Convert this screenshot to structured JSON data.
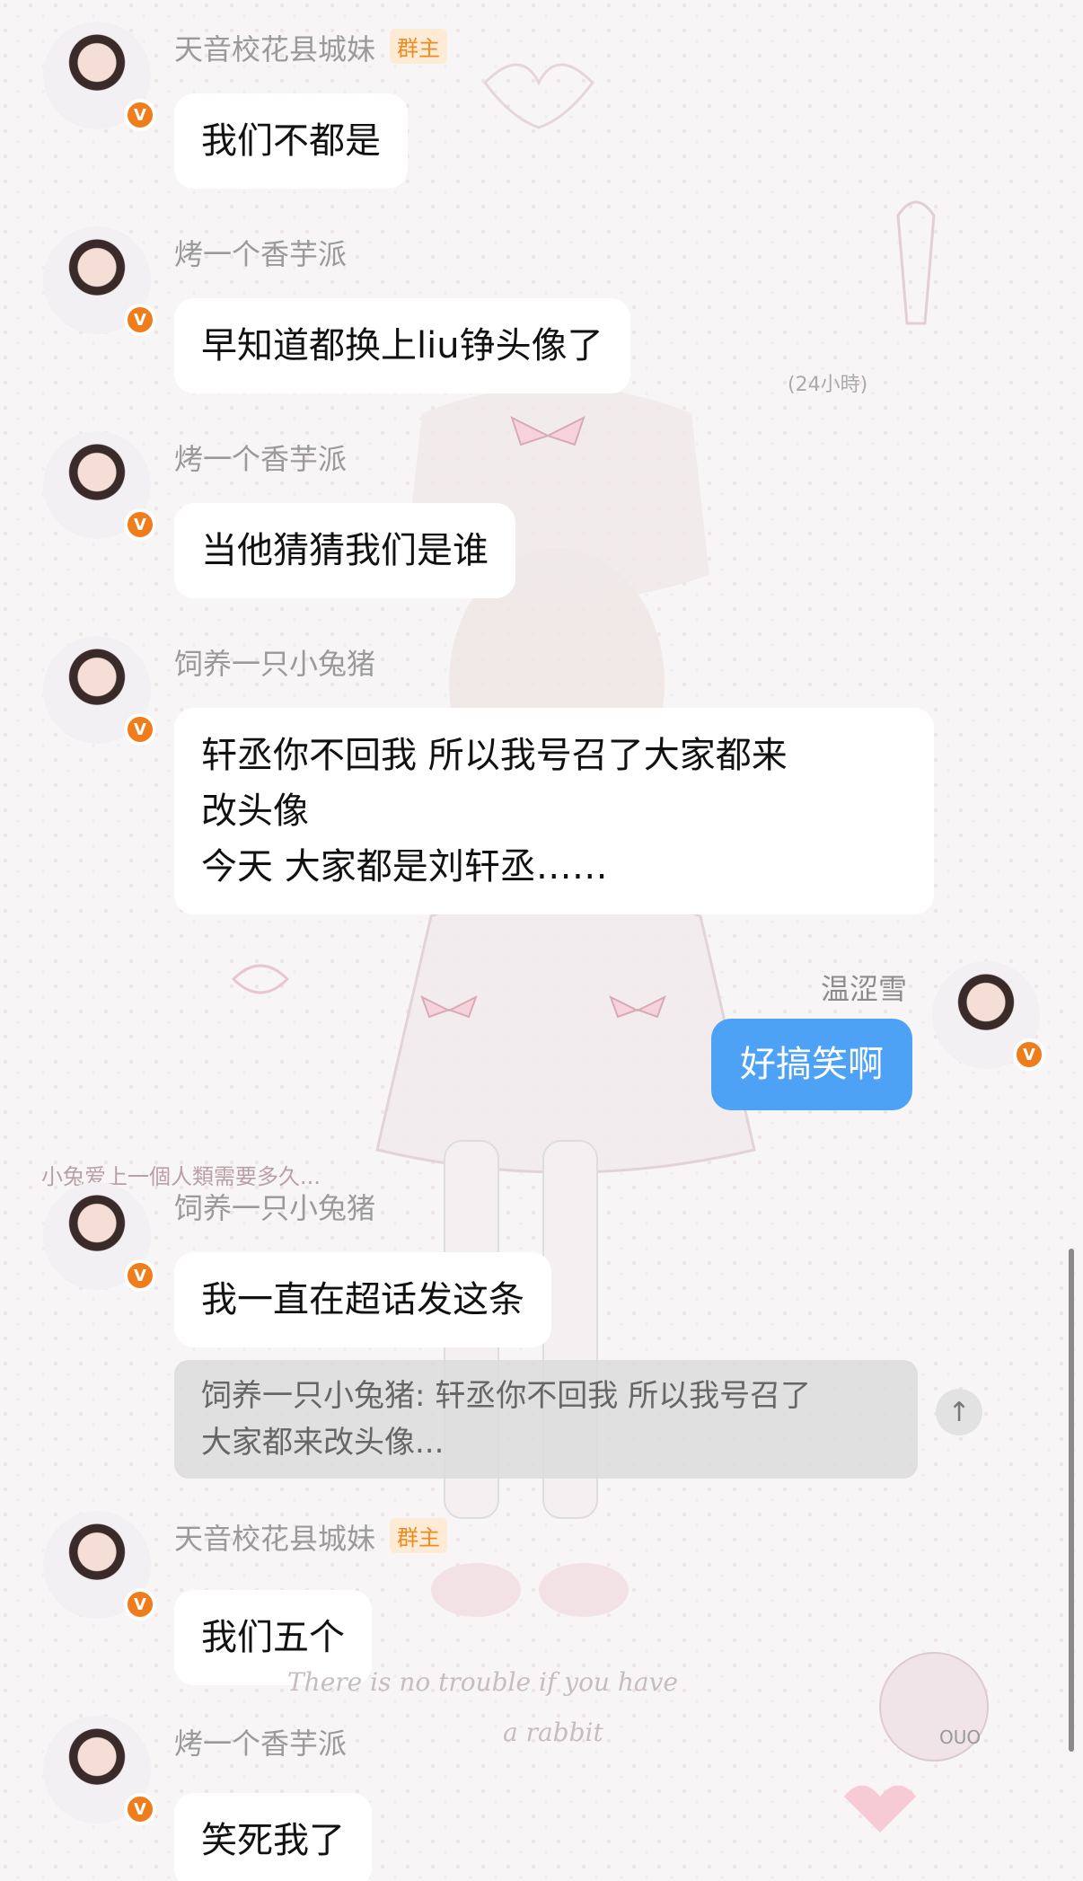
{
  "messages": [
    {
      "sender": "天音校花县城妹",
      "role": "群主",
      "text": "我们不都是"
    },
    {
      "sender": "烤一个香芋派",
      "text": "早知道都换上liu铮头像了"
    },
    {
      "sender": "烤一个香芋派",
      "text": "当他猜猜我们是谁"
    },
    {
      "sender": "饲养一只小兔猪",
      "text": "轩丞你不回我 所以我号召了大家都来\n改头像\n今天 大家都是刘轩丞……"
    },
    {
      "sender": "温涩雪",
      "text": "好搞笑啊",
      "self": true
    },
    {
      "sender": "饲养一只小兔猪",
      "text": "我一直在超话发这条",
      "quote": "饲养一只小兔猪: 轩丞你不回我 所以我号召了\n大家都来改头像..."
    },
    {
      "sender": "天音校花县城妹",
      "role": "群主",
      "text": "我们五个"
    },
    {
      "sender": "烤一个香芋派",
      "text": "笑死我了"
    }
  ],
  "badge_letter": "V",
  "timestamp": "(24小時)",
  "overlay_caption": "小兔爱上一個人類需要多久...",
  "scroll_top_icon": "↑",
  "decor": {
    "line1": "There is no trouble if you have",
    "line2": "a rabbit",
    "ouo": "OUO"
  },
  "colors": {
    "self_bubble": "#4da2f5",
    "verified_badge": "#f07d1b",
    "owner_badge_bg": "#fdebd6",
    "owner_badge_text": "#f08a1e"
  }
}
